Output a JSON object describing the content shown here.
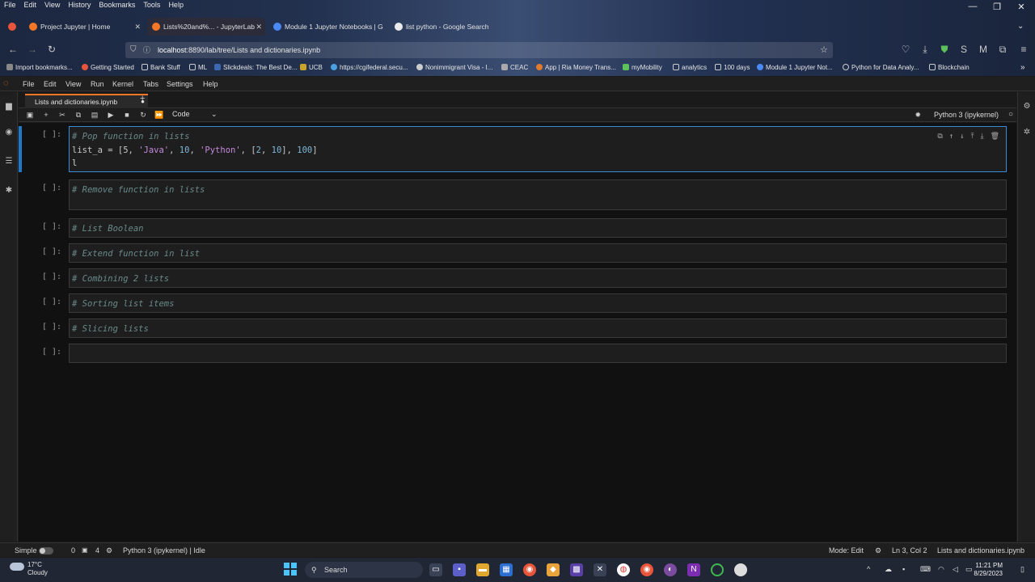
{
  "browser": {
    "menu": [
      "File",
      "Edit",
      "View",
      "History",
      "Bookmarks",
      "Tools",
      "Help"
    ],
    "tabs": [
      {
        "label": "Project Jupyter | Home",
        "active": false
      },
      {
        "label": "Lists%20and%... - JupyterLab",
        "active": true
      },
      {
        "label": "Module 1 Jupyter Notebooks | G",
        "active": false
      },
      {
        "label": "list python - Google Search",
        "active": false
      }
    ],
    "url_host": "localhost",
    "url_path": ":8890/lab/tree/Lists and dictionaries.ipynb",
    "bookmarks": [
      "Import bookmarks...",
      "Getting Started",
      "Bank Stuff",
      "ML",
      "Slickdeals: The Best De...",
      "UCB",
      "https://cgifederal.secu...",
      "Nonimmigrant Visa - I...",
      "CEAC",
      "App | Ria Money Trans...",
      "myMobility",
      "analytics",
      "100 days",
      "Module 1 Jupyter Not...",
      "Python for Data Analy...",
      "Blockchain"
    ]
  },
  "jupyter": {
    "menu": [
      "File",
      "Edit",
      "View",
      "Run",
      "Kernel",
      "Tabs",
      "Settings",
      "Help"
    ],
    "doc_tab": "Lists and dictionaries.ipynb",
    "cell_type": "Code",
    "kernel": "Python 3 (ipykernel)",
    "cells": [
      {
        "prompt": "[ ]:",
        "line1": "# Pop function in lists",
        "line2_parts": [
          "list_a = [5, ",
          "'Java'",
          ", ",
          "10",
          ", ",
          "'Python'",
          ", [",
          "2",
          ", ",
          "10",
          "], ",
          "100",
          "]"
        ],
        "line3": "l"
      },
      {
        "prompt": "[ ]:",
        "comment": "# Remove function in lists"
      },
      {
        "prompt": "[ ]:",
        "comment": "# List Boolean"
      },
      {
        "prompt": "[ ]:",
        "comment": "# Extend function in list"
      },
      {
        "prompt": "[ ]:",
        "comment": "# Combining 2 lists"
      },
      {
        "prompt": "[ ]:",
        "comment": "# Sorting list items"
      },
      {
        "prompt": "[ ]:",
        "comment": "# Slicing lists"
      },
      {
        "prompt": "[ ]:",
        "comment": ""
      }
    ],
    "status": {
      "mode_label": "Simple",
      "count_a": "0",
      "count_b": "4",
      "kernel_status": "Python 3 (ipykernel) | Idle",
      "mode": "Mode: Edit",
      "position": "Ln 3, Col 2",
      "file": "Lists and dictionaries.ipynb"
    }
  },
  "taskbar": {
    "temp": "17°C",
    "weather": "Cloudy",
    "search": "Search",
    "time": "11:21 PM",
    "date": "8/29/2023"
  }
}
